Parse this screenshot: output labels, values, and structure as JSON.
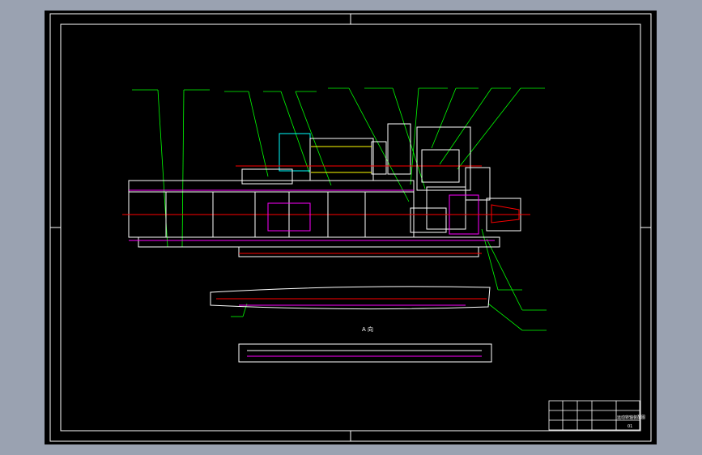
{
  "colors": {
    "background": "#9aa2b1",
    "sheet": "#000000",
    "outline": "#ffffff",
    "leader": "#00ff00",
    "center_line": "#ff0000",
    "hatch": "#ff00ff",
    "part": "#ffffff",
    "accent": "#00ffff",
    "yellow": "#ffff00"
  },
  "view_label": "A 向",
  "title_block": {
    "label": "运动转轴装配图",
    "sheet_no": "01"
  }
}
